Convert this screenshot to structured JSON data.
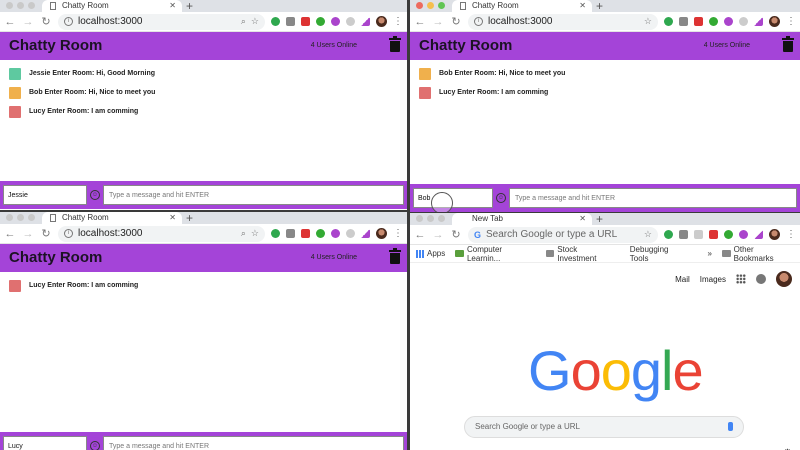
{
  "chatty": {
    "tab_title": "Chatty Room",
    "url": "localhost:3000",
    "app_title": "Chatty Room",
    "online_count": "4 Users Online",
    "message_placeholder": "Type a message and hit ENTER"
  },
  "windows": [
    {
      "username": "Jessie",
      "messages": [
        {
          "avatar_color": "#5ec9a0",
          "text": "Jessie Enter Room: Hi, Good Morning"
        },
        {
          "avatar_color": "#f0b04c",
          "text": "Bob Enter Room: Hi, Nice to meet you"
        },
        {
          "avatar_color": "#e07070",
          "text": "Lucy Enter Room: I am comming"
        }
      ]
    },
    {
      "username": "Bob",
      "messages": [
        {
          "avatar_color": "#f0b04c",
          "text": "Bob Enter Room: Hi, Nice to meet you"
        },
        {
          "avatar_color": "#e07070",
          "text": "Lucy Enter Room: I am comming"
        }
      ]
    },
    {
      "username": "Lucy",
      "messages": [
        {
          "avatar_color": "#e07070",
          "text": "Lucy Enter Room: I am comming"
        }
      ]
    }
  ],
  "newtab": {
    "tab_title": "New Tab",
    "omnibox_placeholder": "Search Google or type a URL",
    "bookmarks": [
      "Apps",
      "Computer Learnin...",
      "Stock Investment",
      "Debugging Tools"
    ],
    "other_bookmarks": "Other Bookmarks",
    "overflow": "»",
    "links": [
      "Mail",
      "Images"
    ],
    "logo_letters": [
      {
        "ch": "G",
        "color": "#4285f4"
      },
      {
        "ch": "o",
        "color": "#ea4335"
      },
      {
        "ch": "o",
        "color": "#fbbc05"
      },
      {
        "ch": "g",
        "color": "#4285f4"
      },
      {
        "ch": "l",
        "color": "#34a853"
      },
      {
        "ch": "e",
        "color": "#ea4335"
      }
    ],
    "search_placeholder": "Search Google or type a URL"
  },
  "colors": {
    "app_purple": "#a444d8"
  }
}
